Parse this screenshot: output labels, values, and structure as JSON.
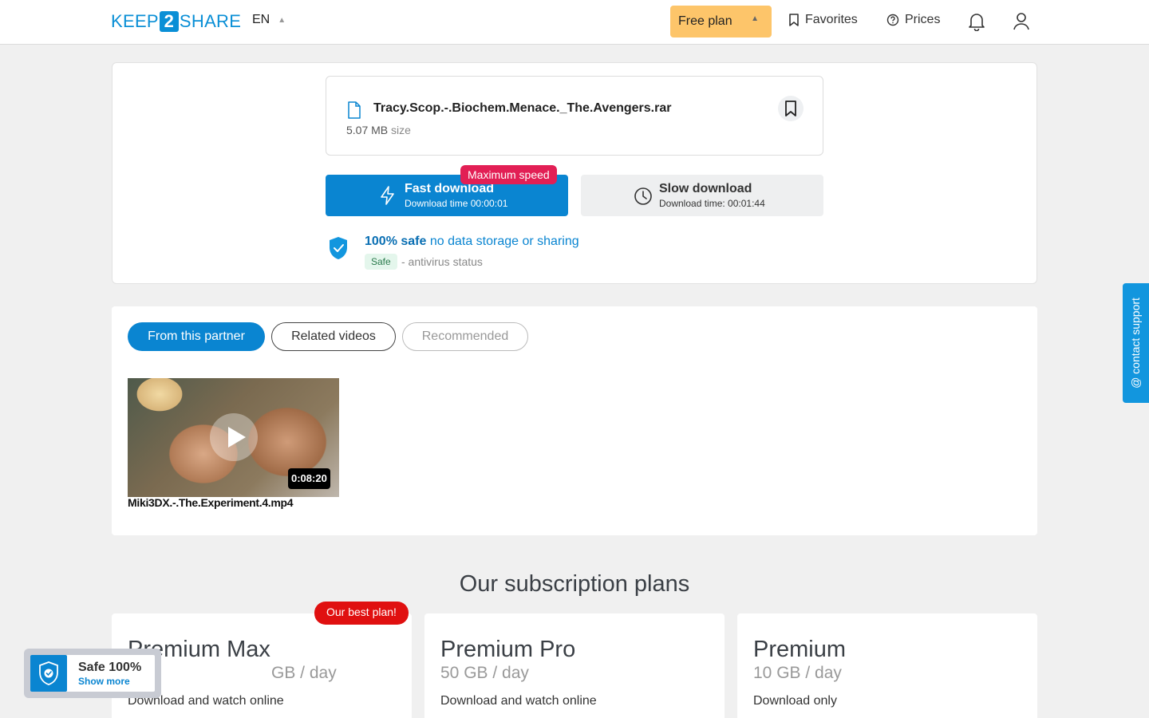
{
  "header": {
    "logo_left": "KEEP",
    "logo_mid": "2",
    "logo_right": "SHARE",
    "language": "EN",
    "plan_button": "Free plan",
    "favorites": "Favorites",
    "prices": "Prices"
  },
  "file": {
    "name": "Tracy.Scop.-.Biochem.Menace._The.Avengers.rar",
    "size_value": "5.07 MB",
    "size_label": "size"
  },
  "download": {
    "badge": "Maximum speed",
    "fast_title": "Fast download",
    "fast_time": "Download time 00:00:01",
    "slow_title": "Slow download",
    "slow_time": "Download time: 00:01:44"
  },
  "safety": {
    "headline_bold": "100% safe",
    "headline_rest": "no data storage or sharing",
    "badge": "Safe",
    "status_text": "- antivirus status"
  },
  "tabs": [
    "From this partner",
    "Related videos",
    "Recommended"
  ],
  "videos": [
    {
      "title": "Miki3DX.-.The.Experiment.4.mp4",
      "duration": "0:08:20"
    }
  ],
  "plans": {
    "heading": "Our subscription plans",
    "best_badge": "Our best plan!",
    "items": [
      {
        "name": "Premium Max",
        "quota": "GB / day",
        "desc": "Download and watch online"
      },
      {
        "name": "Premium Pro",
        "quota": "50 GB / day",
        "desc": "Download and watch online"
      },
      {
        "name": "Premium",
        "quota": "10 GB / day",
        "desc": "Download only"
      }
    ]
  },
  "safe_widget": {
    "title": "Safe 100%",
    "link": "Show more"
  },
  "support": {
    "label": "contact support"
  },
  "colors": {
    "accent": "#0a85d1",
    "plan_button": "#fdc56a",
    "badge_red": "#e21f55",
    "best_red": "#e01010"
  }
}
